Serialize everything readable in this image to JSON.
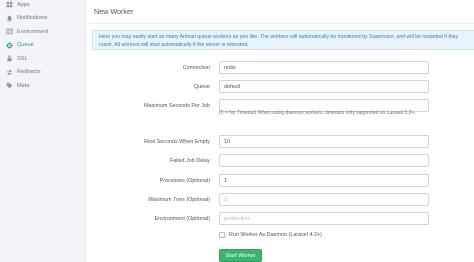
{
  "sidebar": {
    "items": [
      {
        "label": "Apps",
        "icon": "apps-icon"
      },
      {
        "label": "Notifications",
        "icon": "notifications-icon"
      },
      {
        "label": "Environment",
        "icon": "environment-icon"
      },
      {
        "label": "Queue",
        "icon": "queue-icon",
        "active": true
      },
      {
        "label": "SSL",
        "icon": "ssl-icon"
      },
      {
        "label": "Redirects",
        "icon": "redirects-icon"
      },
      {
        "label": "Meta",
        "icon": "meta-icon"
      }
    ]
  },
  "panel": {
    "title": "New Worker",
    "info": "Here you may easily start as many Artisan queue workers as you like. The workers will automatically be monitored by Supervisor, and will be restarted if they crash. All workers will start automatically if the server is rebooted."
  },
  "form": {
    "connection": {
      "label": "Connection",
      "value": "redis"
    },
    "queue": {
      "label": "Queue",
      "value": "default"
    },
    "max_seconds": {
      "label": "Maximum Seconds Per Job",
      "value": "",
      "help": "(0 = No Timeout) When using daemon workers, timeouts only supported on Laravel 5.3+."
    },
    "rest_seconds": {
      "label": "Rest Seconds When Empty",
      "value": "10"
    },
    "failed_delay": {
      "label": "Failed Job Delay",
      "value": ""
    },
    "processes": {
      "label": "Processes (Optional)",
      "value": "1"
    },
    "max_tries": {
      "label": "Maximum Tries (Optional)",
      "placeholder": "3"
    },
    "environment": {
      "label": "Environment (Optional)",
      "placeholder": "production"
    },
    "daemon": {
      "label": "Run Worker As Daemon (Laravel 4.2+)",
      "checked": false
    },
    "submit_label": "Start Worker"
  },
  "colors": {
    "accent": "#3cb371",
    "active_nav": "#3e9b6f",
    "info_bg": "#e8f4fc",
    "info_text": "#3b7bb0"
  }
}
